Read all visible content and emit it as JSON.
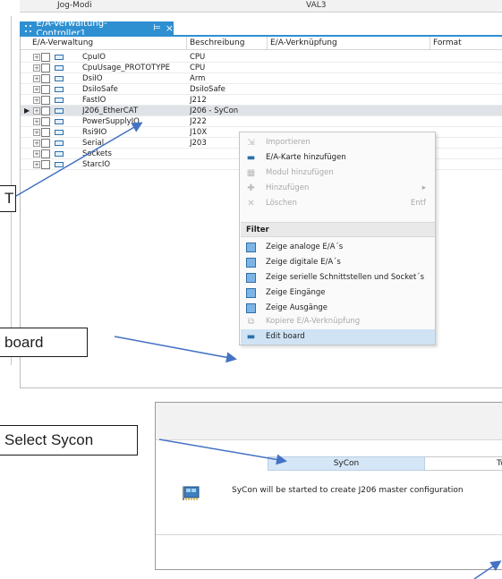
{
  "topbar": {
    "left_text": "Jog-Modi",
    "right_text": "VAL3"
  },
  "tab": {
    "title": "E/A-Verwaltung-Controller1",
    "pin_glyph": "⊨",
    "close_glyph": "×"
  },
  "grid": {
    "headers": [
      "E/A-Verwaltung",
      "Beschreibung",
      "E/A-Verknüpfung",
      "Format"
    ],
    "rows": [
      {
        "name": "CpuIO",
        "desc": "CPU"
      },
      {
        "name": "CpuUsage_PROTOTYPE",
        "desc": "CPU"
      },
      {
        "name": "DsiIO",
        "desc": "Arm"
      },
      {
        "name": "DsiIoSafe",
        "desc": "DsiIoSafe"
      },
      {
        "name": "FastIO",
        "desc": "J212"
      },
      {
        "name": "J206_EtherCAT",
        "desc": "J206 - SyCon"
      },
      {
        "name": "PowerSupplyIO",
        "desc": "J222"
      },
      {
        "name": "Rsi9IO",
        "desc": "J10X"
      },
      {
        "name": "Serial",
        "desc": "J203"
      },
      {
        "name": "Sockets",
        "desc": ""
      },
      {
        "name": "StarcIO",
        "desc": ""
      }
    ]
  },
  "context_menu": {
    "items_top": [
      {
        "label": "Importieren",
        "icon": "import-icon",
        "disabled": true
      },
      {
        "label": "E/A-Karte hinzufügen",
        "icon": "add-card-icon",
        "disabled": false
      },
      {
        "label": "Modul hinzufügen",
        "icon": "add-module-icon",
        "disabled": true
      },
      {
        "label": "Hinzufügen",
        "icon": "add-icon",
        "disabled": true,
        "submenu": "▸"
      },
      {
        "label": "Löschen",
        "icon": "delete-icon",
        "disabled": true,
        "shortcut": "Entf"
      }
    ],
    "filter_header": "Filter",
    "items_filter": [
      {
        "label": "Zeige analoge E/A´s",
        "icon": "analog-io-icon"
      },
      {
        "label": "Zeige digitale E/A´s",
        "icon": "digital-io-icon"
      },
      {
        "label": "Zeige serielle Schnittstellen und Socket´s",
        "icon": "serial-socket-icon"
      },
      {
        "label": "Zeige Eingänge",
        "icon": "filter-input-icon"
      },
      {
        "label": "Zeige Ausgänge",
        "icon": "filter-output-icon"
      }
    ],
    "items_bottom": [
      {
        "label": "Kopiere E/A-Verknüpfung",
        "icon": "copy-icon",
        "disabled": true
      },
      {
        "label": "Edit board",
        "icon": "edit-board-icon",
        "highlighted": true
      }
    ]
  },
  "callouts": {
    "t_fragment": "T",
    "board_fragment": "board",
    "select_sycon": "Select Sycon"
  },
  "dialog": {
    "tab_sycon": "SyCon",
    "tab_twin_fragment": "Twin",
    "message": "SyCon will be started to create J206 master configuration"
  },
  "colors": {
    "accent": "#2e8fd1",
    "selected_row": "#dfe3e8",
    "menu_highlight": "#cfe3f5",
    "arrow": "#4472c4"
  }
}
